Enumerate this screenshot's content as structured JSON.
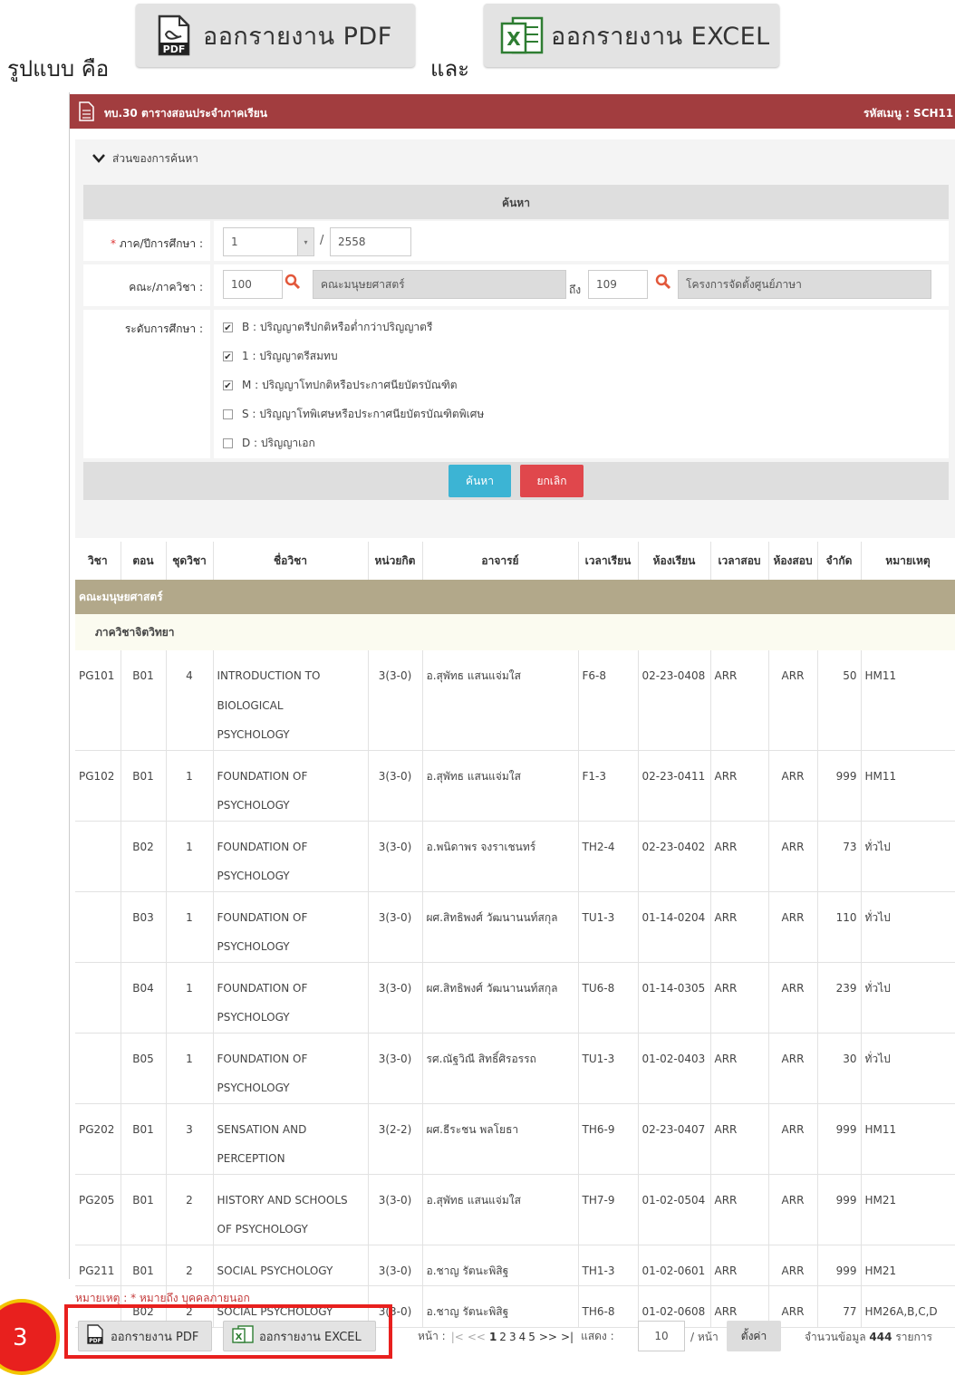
{
  "intro": {
    "format_label": "รูปแบบ คือ",
    "and_label": "และ",
    "pdf_button": "ออกรายงาน PDF",
    "excel_button": "ออกรายงาน EXCEL"
  },
  "header": {
    "title": "ทบ.30 ตารางสอนประจำภาคเรียน",
    "menu_code": "รหัสเมนู : SCH11"
  },
  "search": {
    "section_toggle": "ส่วนของการค้นหา",
    "bar_title": "ค้นหา",
    "required_mark": "*",
    "term_label": "ภาค/ปีการศึกษา :",
    "term_value": "1",
    "slash": "/",
    "year_value": "2558",
    "faculty_label": "คณะ/ภาควิชา :",
    "faculty_from_code": "100",
    "faculty_from_name": "คณะมนุษยศาสตร์",
    "to_label": "ถึง",
    "faculty_to_code": "109",
    "faculty_to_name": "โครงการจัดตั้งศูนย์ภาษา",
    "level_label": "ระดับการศึกษา :",
    "levels": [
      {
        "text": "B : ปริญญาตรีปกติหรือต่ำกว่าปริญญาตรี",
        "checked": true
      },
      {
        "text": "1 : ปริญญาตรีสมทบ",
        "checked": true
      },
      {
        "text": "M : ปริญญาโทปกติหรือประกาศนียบัตรบัณฑิต",
        "checked": true
      },
      {
        "text": "S : ปริญญาโทพิเศษหรือประกาศนียบัตรบัณฑิตพิเศษ",
        "checked": false
      },
      {
        "text": "D : ปริญญาเอก",
        "checked": false
      }
    ],
    "search_button": "ค้นหา",
    "cancel_button": "ยกเลิก"
  },
  "table": {
    "headers": [
      "วิชา",
      "ตอน",
      "ชุดวิชา",
      "ชื่อวิชา",
      "หน่วยกิต",
      "อาจารย์",
      "เวลาเรียน",
      "ห้องเรียน",
      "เวลาสอบ",
      "ห้องสอบ",
      "จำกัด",
      "หมายเหตุ"
    ],
    "faculty": "คณะมนุษยศาสตร์",
    "department": "ภาควิชาจิตวิทยา",
    "rows": [
      {
        "code": "PG101",
        "sec": "B01",
        "set": "4",
        "lines": [
          "INTRODUCTION TO",
          "BIOLOGICAL",
          "PSYCHOLOGY"
        ],
        "credit": "3(3-0)",
        "teacher": "อ.สุพัทธ แสนแจ่มใส",
        "time": "F6-8",
        "room": "02-23-0408",
        "exam": "ARR",
        "exam_room": "ARR",
        "limit": "50",
        "note": "HM11"
      },
      {
        "code": "PG102",
        "sec": "B01",
        "set": "1",
        "lines": [
          "FOUNDATION OF",
          "PSYCHOLOGY"
        ],
        "credit": "3(3-0)",
        "teacher": "อ.สุพัทธ แสนแจ่มใส",
        "time": "F1-3",
        "room": "02-23-0411",
        "exam": "ARR",
        "exam_room": "ARR",
        "limit": "999",
        "note": "HM11"
      },
      {
        "code": "",
        "sec": "B02",
        "set": "1",
        "lines": [
          "FOUNDATION OF",
          "PSYCHOLOGY"
        ],
        "credit": "3(3-0)",
        "teacher": "อ.พนิดาพร จงราเชนทร์",
        "time": "TH2-4",
        "room": "02-23-0402",
        "exam": "ARR",
        "exam_room": "ARR",
        "limit": "73",
        "note": "ทั่วไป"
      },
      {
        "code": "",
        "sec": "B03",
        "set": "1",
        "lines": [
          "FOUNDATION OF",
          "PSYCHOLOGY"
        ],
        "credit": "3(3-0)",
        "teacher": "ผศ.สิทธิพงศ์ วัฒนานนท์สกุล",
        "time": "TU1-3",
        "room": "01-14-0204",
        "exam": "ARR",
        "exam_room": "ARR",
        "limit": "110",
        "note": "ทั่วไป"
      },
      {
        "code": "",
        "sec": "B04",
        "set": "1",
        "lines": [
          "FOUNDATION OF",
          "PSYCHOLOGY"
        ],
        "credit": "3(3-0)",
        "teacher": "ผศ.สิทธิพงศ์ วัฒนานนท์สกุล",
        "time": "TU6-8",
        "room": "01-14-0305",
        "exam": "ARR",
        "exam_room": "ARR",
        "limit": "239",
        "note": "ทั่วไป"
      },
      {
        "code": "",
        "sec": "B05",
        "set": "1",
        "lines": [
          "FOUNDATION OF",
          "PSYCHOLOGY"
        ],
        "credit": "3(3-0)",
        "teacher": "รศ.ณัฐวิณี สิทธิ์ศิรอรรถ",
        "time": "TU1-3",
        "room": "01-02-0403",
        "exam": "ARR",
        "exam_room": "ARR",
        "limit": "30",
        "note": "ทั่วไป"
      },
      {
        "code": "PG202",
        "sec": "B01",
        "set": "3",
        "lines": [
          "SENSATION AND",
          "PERCEPTION"
        ],
        "credit": "3(2-2)",
        "teacher": "ผศ.ธีระชน พลโยธา",
        "time": "TH6-9",
        "room": "02-23-0407",
        "exam": "ARR",
        "exam_room": "ARR",
        "limit": "999",
        "note": "HM11"
      },
      {
        "code": "PG205",
        "sec": "B01",
        "set": "2",
        "lines": [
          "HISTORY AND SCHOOLS",
          "OF PSYCHOLOGY"
        ],
        "credit": "3(3-0)",
        "teacher": "อ.สุพัทธ แสนแจ่มใส",
        "time": "TH7-9",
        "room": "01-02-0504",
        "exam": "ARR",
        "exam_room": "ARR",
        "limit": "999",
        "note": "HM21"
      },
      {
        "code": "PG211",
        "sec": "B01",
        "set": "2",
        "lines": [
          "SOCIAL PSYCHOLOGY"
        ],
        "credit": "3(3-0)",
        "teacher": "อ.ชาญ รัตนะพิสิฐ",
        "time": "TH1-3",
        "room": "01-02-0601",
        "exam": "ARR",
        "exam_room": "ARR",
        "limit": "999",
        "note": "HM21"
      },
      {
        "code": "",
        "sec": "B02",
        "set": "2",
        "lines": [
          "SOCIAL PSYCHOLOGY"
        ],
        "credit": "3(3-0)",
        "teacher": "อ.ชาญ รัตนะพิสิฐ",
        "time": "TH6-8",
        "room": "01-02-0608",
        "exam": "ARR",
        "exam_room": "ARR",
        "limit": "77",
        "note": "HM26A,B,C,D"
      }
    ]
  },
  "footer": {
    "remark": "หมายเหตุ : * หมายถึง บุคคลภายนอก",
    "step_number": "3",
    "pdf_button": "ออกรายงาน PDF",
    "excel_button": "ออกรายงาน EXCEL",
    "page_label": "หน้า :",
    "first": "|<",
    "prev": "<<",
    "pages": [
      "1",
      "2",
      "3",
      "4",
      "5"
    ],
    "next": ">>",
    "last": ">|",
    "show_label": "แสดง :",
    "page_size": "10",
    "per_page_label": "/ หน้า",
    "set_button": "ตั้งค่า",
    "total_prefix": "จำนวนข้อมูล",
    "total_count": "444",
    "total_suffix": "รายการ"
  },
  "colors": {
    "header_bg": "#a23d3f",
    "faculty_row": "#b2a88a",
    "search_btn": "#3cb4d4",
    "cancel_btn": "#e0474c",
    "highlight": "#e8201e",
    "step_circle": "#f2c400"
  }
}
